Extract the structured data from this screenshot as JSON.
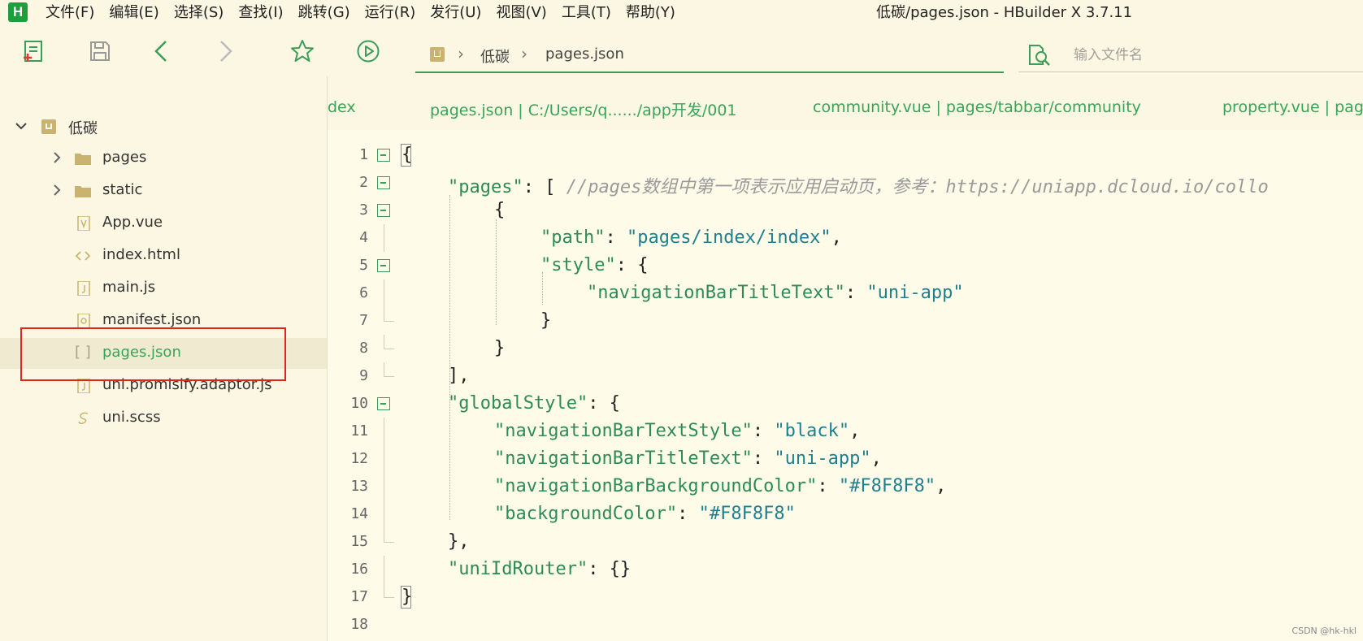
{
  "app": {
    "logo": "H",
    "window_title": "低碳/pages.json - HBuilder X 3.7.11"
  },
  "menu": [
    "文件(F)",
    "编辑(E)",
    "选择(S)",
    "查找(I)",
    "跳转(G)",
    "运行(R)",
    "发行(U)",
    "视图(V)",
    "工具(T)",
    "帮助(Y)"
  ],
  "toolbar": {
    "buttons": [
      "new-file-icon",
      "save-icon",
      "back-icon",
      "forward-icon",
      "favorite-icon",
      "run-icon"
    ],
    "breadcrumb": [
      "低碳",
      "pages.json"
    ],
    "search_placeholder": "输入文件名"
  },
  "sidebar": {
    "project": "低碳",
    "items": [
      {
        "label": "pages",
        "type": "folder"
      },
      {
        "label": "static",
        "type": "folder"
      },
      {
        "label": "App.vue",
        "type": "vue"
      },
      {
        "label": "index.html",
        "type": "html"
      },
      {
        "label": "main.js",
        "type": "js"
      },
      {
        "label": "manifest.json",
        "type": "manifest"
      },
      {
        "label": "pages.json",
        "type": "json",
        "selected": true
      },
      {
        "label": "uni.promisify.adaptor.js",
        "type": "js"
      },
      {
        "label": "uni.scss",
        "type": "scss"
      }
    ]
  },
  "tabs": [
    "dex",
    "pages.json | C:/Users/q....../app开发/001",
    "community.vue | pages/tabbar/community",
    "property.vue | pag"
  ],
  "editor": {
    "line_numbers": [
      "1",
      "2",
      "3",
      "4",
      "5",
      "6",
      "7",
      "8",
      "9",
      "10",
      "11",
      "12",
      "13",
      "14",
      "15",
      "16",
      "17",
      "18"
    ],
    "code": {
      "l2_key": "\"pages\"",
      "l2_comment": "//pages数组中第一项表示应用启动页，参考：https://uniapp.dcloud.io/collo",
      "l4_key": "\"path\"",
      "l4_val": "\"pages/index/index\"",
      "l5_key": "\"style\"",
      "l6_key": "\"navigationBarTitleText\"",
      "l6_val": "\"uni-app\"",
      "l10_key": "\"globalStyle\"",
      "l11_key": "\"navigationBarTextStyle\"",
      "l11_val": "\"black\"",
      "l12_key": "\"navigationBarTitleText\"",
      "l12_val": "\"uni-app\"",
      "l13_key": "\"navigationBarBackgroundColor\"",
      "l13_val": "\"#F8F8F8\"",
      "l14_key": "\"backgroundColor\"",
      "l14_val": "\"#F8F8F8\"",
      "l16_key": "\"uniIdRouter\""
    }
  },
  "watermark": "CSDN @hk-hkl",
  "colors": {
    "accent": "#3aa35a",
    "highlight": "#e0261b",
    "background": "#fefbe9"
  }
}
